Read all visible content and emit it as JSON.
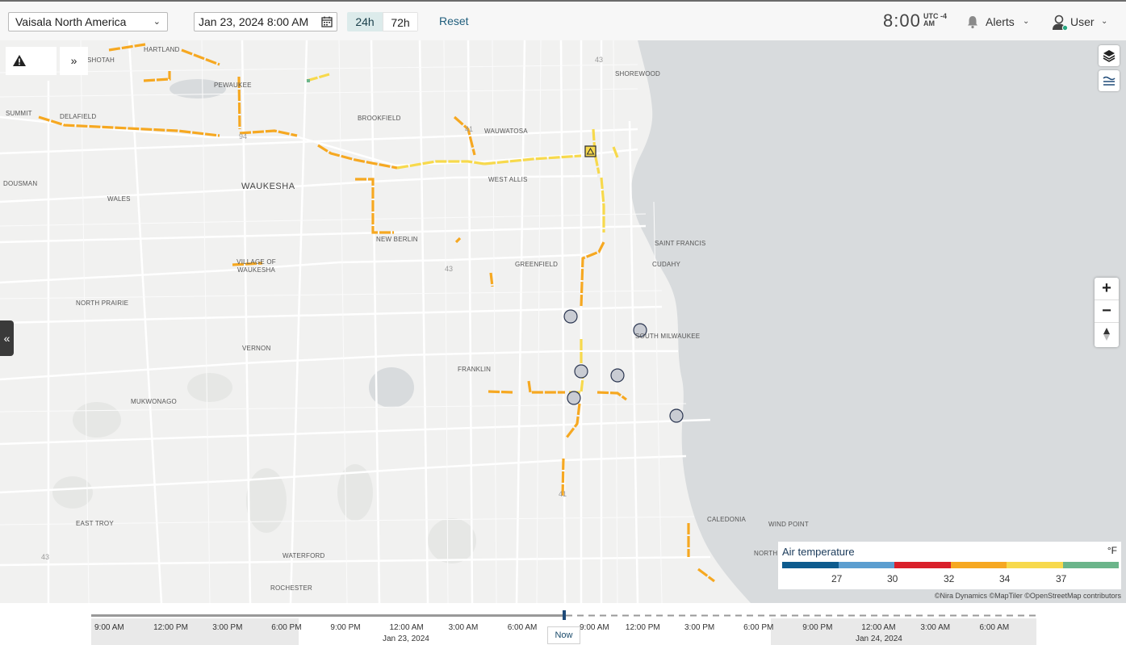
{
  "header": {
    "region": "Vaisala North America",
    "datetime": "Jan 23, 2024 8:00 AM",
    "range_options": [
      "24h",
      "72h"
    ],
    "active_range": "24h",
    "reset_label": "Reset",
    "clock": "8:00",
    "utc_label": "UTC -4",
    "ampm": "AM",
    "alerts_label": "Alerts",
    "user_label": "User"
  },
  "map": {
    "places": [
      "HARTLAND",
      "SHOTAH",
      "PEWAUKEE",
      "SUMMIT",
      "DELAFIELD",
      "BROOKFIELD",
      "WAUWATOSA",
      "WEST ALLIS",
      "SHOREWOOD",
      "WAUKESHA",
      "DOUSMAN",
      "WALES",
      "NEW BERLIN",
      "VILLAGE OF WAUKESHA",
      "GREENFIELD",
      "SAINT FRANCIS",
      "CUDAHY",
      "NORTH PRAIRIE",
      "SOUTH MILWAUKEE",
      "VERNON",
      "FRANKLIN",
      "MUKWONAGO",
      "EAST TROY",
      "CALEDONIA",
      "WIND POINT",
      "NORTH B",
      "WATERFORD",
      "ROCHESTER"
    ],
    "shields": [
      "43",
      "41",
      "94",
      "43",
      "41",
      "43"
    ],
    "alert_icon": "warning-icon",
    "expand_icon": "double-chevron-right-icon",
    "collapse_icon": "double-chevron-left-icon",
    "layers_icon": "layers-icon",
    "filter_icon": "lines-icon",
    "zoom_in": "+",
    "zoom_out": "−",
    "attribution": "©Nira Dynamics ©MapTiler ©OpenStreetMap contributors"
  },
  "legend": {
    "title": "Air temperature",
    "unit": "°F",
    "colors": [
      "#0d5b8e",
      "#5b9ed0",
      "#d9202a",
      "#f6a821",
      "#f7d94c",
      "#6bb58a"
    ],
    "ticks": [
      "27",
      "30",
      "32",
      "34",
      "37"
    ]
  },
  "timeline": {
    "labels": [
      "9:00 AM",
      "12:00 PM",
      "3:00 PM",
      "6:00 PM",
      "9:00 PM",
      "12:00 AM",
      "3:00 AM",
      "6:00 AM",
      "9:00 AM",
      "12:00 PM",
      "3:00 PM",
      "6:00 PM",
      "9:00 PM",
      "12:00 AM",
      "3:00 AM",
      "6:00 AM"
    ],
    "dates": [
      "Jan 23, 2024",
      "Jan 24, 2024"
    ],
    "now_label": "Now"
  }
}
